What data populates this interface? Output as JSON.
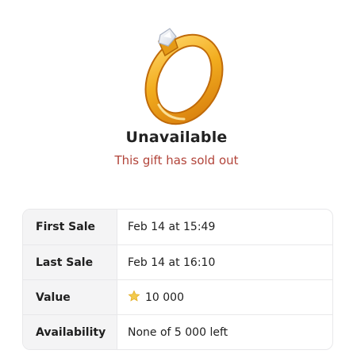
{
  "status": {
    "title": "Unavailable",
    "subtitle": "This gift has sold out"
  },
  "details": [
    {
      "label": "First Sale",
      "value": "Feb 14 at 15:49"
    },
    {
      "label": "Last Sale",
      "value": "Feb 14 at 16:10"
    },
    {
      "label": "Value",
      "value": "10 000",
      "icon": "star-icon"
    },
    {
      "label": "Availability",
      "value": "None of 5 000 left"
    }
  ],
  "colors": {
    "subtitle": "#b2443a",
    "star": "#f2c94c",
    "gift_gold": "#f4b52a"
  },
  "gift_icon": "ring-icon"
}
